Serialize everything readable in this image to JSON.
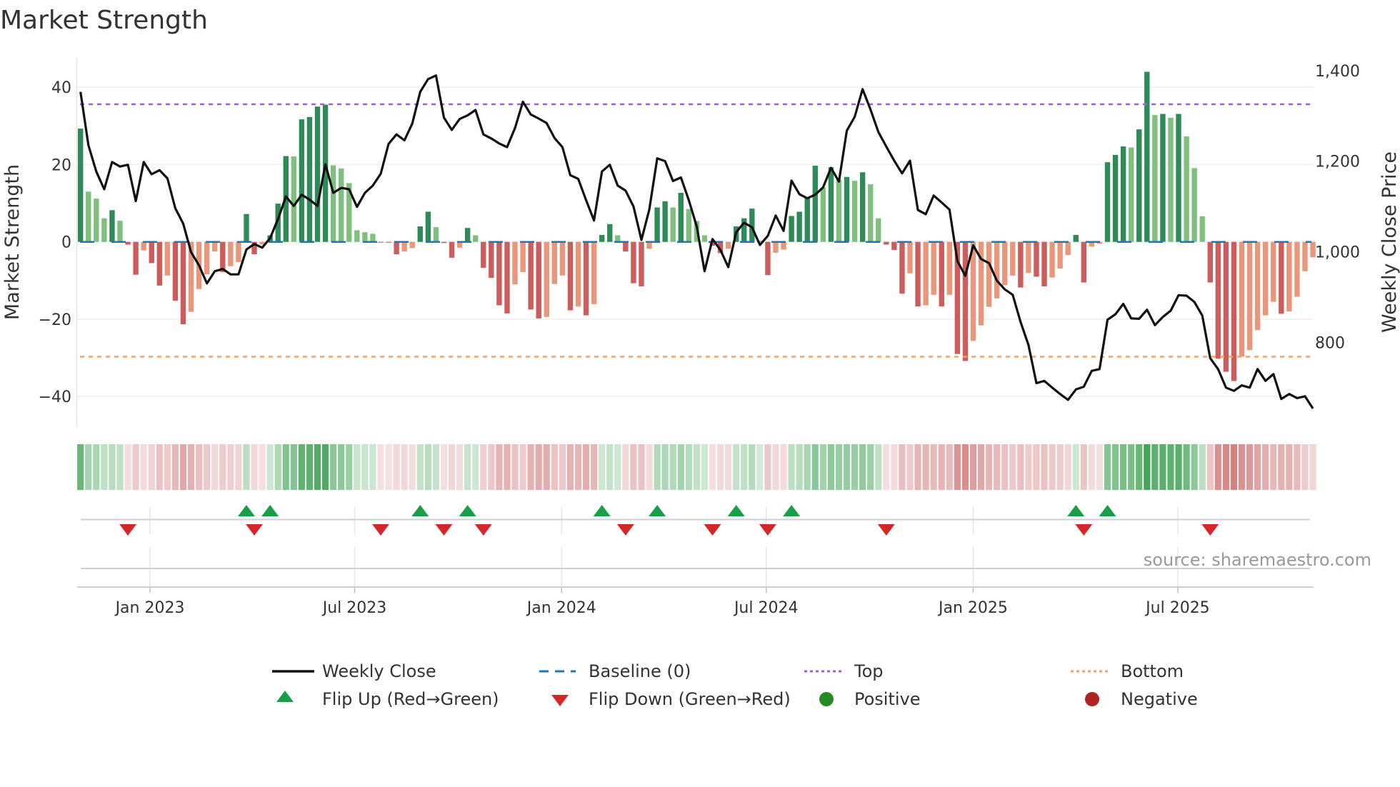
{
  "title": "Market Strength",
  "source": "source: sharemaestro.com",
  "colors": {
    "strong_up": "#2e8b57",
    "weak_up": "#7fc07f",
    "strong_down": "#cd5c5c",
    "weak_down": "#e9967a",
    "close_line": "#111111",
    "baseline": "#1f77b4",
    "top": "#9b5fe0",
    "bottom": "#f4a460",
    "flip_up": "#1a9e48",
    "flip_down": "#d62728",
    "positive": "#228b22",
    "negative": "#b22222"
  },
  "legend": {
    "weekly_close": "Weekly Close",
    "baseline": "Baseline (0)",
    "top": "Top",
    "bottom": "Bottom",
    "flip_up": "Flip Up (Red→Green)",
    "flip_down": "Flip Down (Green→Red)",
    "positive": "Positive",
    "negative": "Negative"
  },
  "chart_data": {
    "type": "bar",
    "title": "Market Strength",
    "xlabel": "",
    "ylabel": "Market Strength",
    "y2label": "Weekly Close Price",
    "ylim": [
      -47.9,
      47.6
    ],
    "y2lim": [
      613,
      1428
    ],
    "yticks": [
      40,
      20,
      0,
      -20,
      -40
    ],
    "ytick_labels": [
      "40",
      "20",
      "0",
      "−20",
      "−40"
    ],
    "y2ticks": [
      1400,
      1200,
      1000,
      800
    ],
    "y2tick_labels": [
      "1,400",
      "1,200",
      "1,000",
      "800"
    ],
    "x_unit": "week index",
    "xticks": [
      8.8,
      34.7,
      60.9,
      86.8,
      113,
      138.9
    ],
    "xtick_labels": [
      "Jan 2023",
      "Jul 2023",
      "Jan 2024",
      "Jul 2024",
      "Jan 2025",
      "Jul 2025"
    ],
    "top_level": 35.6,
    "bottom_level": -29.7,
    "baseline": 0,
    "series": [
      {
        "name": "Market Strength",
        "type": "bar",
        "values": [
          29.3,
          13,
          11.2,
          6.1,
          8.2,
          5.5,
          -0.7,
          -8.5,
          -2.2,
          -5.5,
          -11.3,
          -8.7,
          -15.2,
          -21.3,
          -18.1,
          -12.2,
          -8.4,
          -2.5,
          -7.8,
          -6.3,
          -5.2,
          7.2,
          -3.2,
          -0.7,
          1.7,
          9.9,
          22.2,
          22.1,
          31.7,
          32.3,
          35,
          35.5,
          19.8,
          19,
          15.2,
          3,
          2.5,
          2.1,
          -0.2,
          -0.2,
          -3.2,
          -2.5,
          -1.6,
          4,
          7.8,
          3.8,
          -0.3,
          -4.1,
          -1.5,
          3.6,
          1.7,
          -6.7,
          -9.3,
          -16.4,
          -18.5,
          -11,
          -7.8,
          -17.5,
          -19.8,
          -19.4,
          -10.9,
          -8.7,
          -17.7,
          -16.7,
          -19,
          -16.1,
          1.8,
          4.6,
          1.7,
          -2.5,
          -10.7,
          -11.5,
          -1.8,
          8.9,
          10.5,
          8.9,
          12.7,
          8.5,
          5.4,
          1.7,
          -1,
          -2.9,
          -1.8,
          4,
          6.1,
          8.6,
          0.3,
          -8.6,
          -2.8,
          -2,
          6.7,
          7.8,
          11.5,
          19.7,
          14.1,
          19.3,
          16.1,
          16.8,
          15.8,
          18,
          14.9,
          6.1,
          -0.7,
          -2.1,
          -13.4,
          -8.1,
          -16.7,
          -16.4,
          -13.7,
          -16.7,
          -13.7,
          -29,
          -30.8,
          -25.6,
          -21.6,
          -16.8,
          -14.6,
          -11.2,
          -8.7,
          -11.8,
          -8,
          -9,
          -11.5,
          -9.2,
          -6.9,
          -3.4,
          1.8,
          -10.5,
          -1.2,
          -0.5,
          20.6,
          22.5,
          24.7,
          24.4,
          29.1,
          44,
          32.8,
          33.1,
          32.1,
          33.1,
          27.3,
          19.1,
          6.6,
          -10.5,
          -30.2,
          -33.6,
          -36,
          -29.7,
          -28,
          -22.8,
          -19,
          -15.5,
          -18.6,
          -18,
          -14.2,
          -7.6,
          -4
        ]
      },
      {
        "name": "Weekly Close",
        "type": "line",
        "axis": "right",
        "values": [
          1353,
          1235,
          1177,
          1138,
          1198,
          1188,
          1192,
          1112,
          1198,
          1171,
          1180,
          1162,
          1096,
          1062,
          999,
          970,
          930,
          957,
          962,
          950,
          950,
          1005,
          1017,
          1009,
          1030,
          1072,
          1122,
          1101,
          1126,
          1115,
          1101,
          1193,
          1130,
          1141,
          1138,
          1099,
          1130,
          1146,
          1172,
          1238,
          1259,
          1246,
          1283,
          1353,
          1381,
          1389,
          1296,
          1269,
          1293,
          1301,
          1313,
          1259,
          1250,
          1239,
          1231,
          1273,
          1331,
          1303,
          1294,
          1284,
          1251,
          1231,
          1169,
          1161,
          1114,
          1069,
          1177,
          1192,
          1146,
          1135,
          1100,
          1026,
          1093,
          1206,
          1200,
          1156,
          1164,
          1114,
          1056,
          957,
          1028,
          1004,
          966,
          1043,
          1064,
          1054,
          1015,
          1035,
          1080,
          1046,
          1157,
          1127,
          1118,
          1126,
          1142,
          1185,
          1155,
          1267,
          1298,
          1359,
          1314,
          1264,
          1232,
          1201,
          1173,
          1201,
          1092,
          1083,
          1124,
          1109,
          1093,
          979,
          947,
          1014,
          984,
          975,
          936,
          917,
          905,
          845,
          794,
          710,
          715,
          700,
          686,
          673,
          696,
          702,
          737,
          741,
          850,
          862,
          885,
          853,
          852,
          872,
          838,
          856,
          870,
          904,
          903,
          889,
          859,
          765,
          741,
          700,
          693,
          705,
          700,
          741,
          715,
          730,
          675,
          686,
          677,
          681,
          654
        ]
      }
    ],
    "flips_up": [
      21,
      24,
      43,
      49,
      66,
      73,
      83,
      90,
      126,
      130
    ],
    "flips_down": [
      6,
      22,
      38,
      46,
      51,
      69,
      80,
      87,
      102,
      127,
      143
    ],
    "legend_position": "bottom"
  }
}
